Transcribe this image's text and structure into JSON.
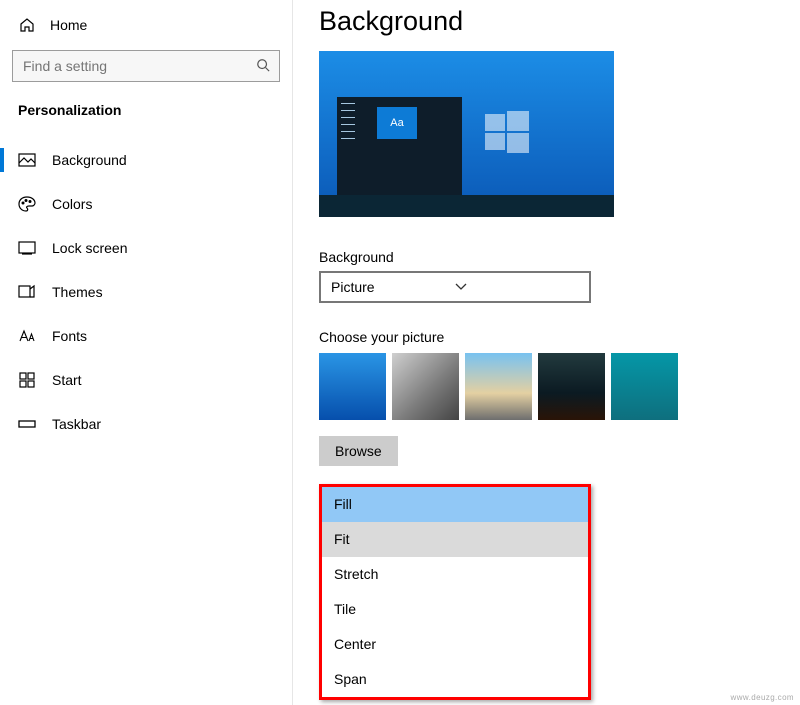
{
  "sidebar": {
    "home_label": "Home",
    "search_placeholder": "Find a setting",
    "section": "Personalization",
    "items": [
      {
        "label": "Background"
      },
      {
        "label": "Colors"
      },
      {
        "label": "Lock screen"
      },
      {
        "label": "Themes"
      },
      {
        "label": "Fonts"
      },
      {
        "label": "Start"
      },
      {
        "label": "Taskbar"
      }
    ]
  },
  "main": {
    "title": "Background",
    "background_label": "Background",
    "background_dropdown_value": "Picture",
    "choose_picture_label": "Choose your picture",
    "browse_label": "Browse",
    "preview_tile_text": "Aa",
    "fit_options": [
      {
        "label": "Fill",
        "state": "selected"
      },
      {
        "label": "Fit",
        "state": "hover"
      },
      {
        "label": "Stretch",
        "state": ""
      },
      {
        "label": "Tile",
        "state": ""
      },
      {
        "label": "Center",
        "state": ""
      },
      {
        "label": "Span",
        "state": ""
      }
    ]
  },
  "watermark": "www.deuzg.com"
}
